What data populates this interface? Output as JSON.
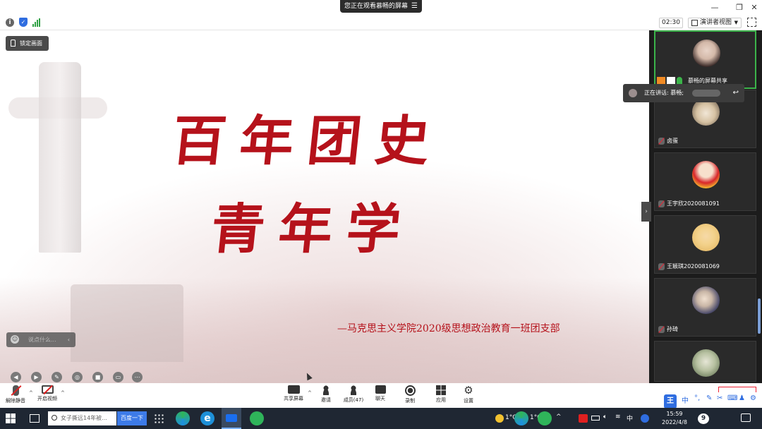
{
  "window": {
    "share_banner": "您正在观看慕畅的屏幕",
    "timer": "02:30",
    "view_mode": "演讲者视图"
  },
  "slide": {
    "title_line1": "百年团史",
    "title_line2": "青年学",
    "subtitle": "—马克思主义学院2020级思想政治教育一班团支部",
    "lock_label": "锁定画面",
    "chat_placeholder": "说点什么..."
  },
  "speaking": {
    "label": "正在讲话: 慕畅;"
  },
  "participants": [
    {
      "name": "慕畅的屏幕共享",
      "kind": "share"
    },
    {
      "name": "卤蛋"
    },
    {
      "name": "王宇欣2020081091"
    },
    {
      "name": "王颖琪2020081069"
    },
    {
      "name": "孙琦"
    },
    {
      "name": ""
    }
  ],
  "controls": {
    "unmute": "解除静音",
    "start_video": "开启视频",
    "share_screen": "共享屏幕",
    "invite": "邀请",
    "members": "成员(47)",
    "chat": "聊天",
    "record": "录制",
    "apps": "应用",
    "settings": "设置"
  },
  "ime": {
    "lang": "中",
    "punct": "°,"
  },
  "taskbar": {
    "search_placeholder": "女子撕远14年被...",
    "baidu_button": "百度一下",
    "temp1": "1°C",
    "temp2": "1°C",
    "ime_lang": "中",
    "time": "15:59",
    "date": "2022/4/8",
    "badge": "9"
  },
  "colors": {
    "slide_red": "#b5121b",
    "active_border": "#3bb34a",
    "panel_bg": "#1c1c1c",
    "taskbar_bg": "#1f2733",
    "accent_blue": "#2f6de0"
  }
}
